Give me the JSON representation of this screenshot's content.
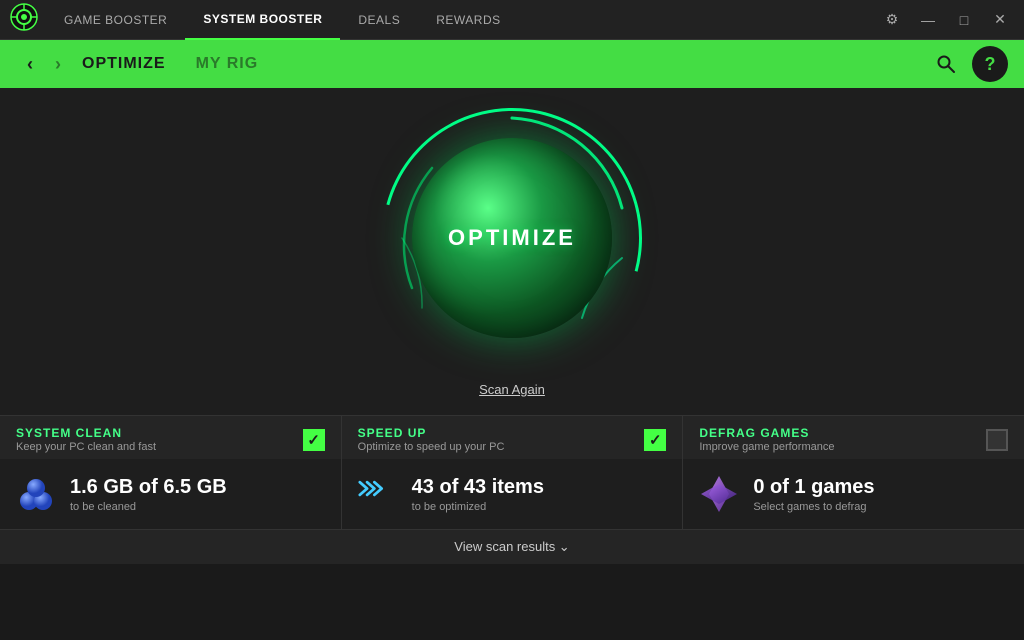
{
  "titlebar": {
    "logo_alt": "Razer Cortex Logo",
    "nav": [
      {
        "label": "GAME BOOSTER",
        "active": false
      },
      {
        "label": "SYSTEM BOOSTER",
        "active": true
      },
      {
        "label": "DEALS",
        "active": false
      },
      {
        "label": "REWARDS",
        "active": false
      }
    ],
    "controls": [
      "settings-icon",
      "minimize-icon",
      "maximize-icon",
      "close-icon"
    ]
  },
  "header": {
    "back_label": "‹",
    "forward_label": "›",
    "tabs": [
      {
        "label": "OPTIMIZE",
        "active": true
      },
      {
        "label": "MY RIG",
        "active": false
      }
    ],
    "search_label": "🔍",
    "help_label": "?"
  },
  "orb": {
    "label": "OPTIMIZE"
  },
  "scan_again": {
    "label": "Scan Again"
  },
  "cards": [
    {
      "id": "system-clean",
      "title": "SYSTEM CLEAN",
      "subtitle": "Keep your PC clean and fast",
      "checked": true,
      "icon": "bubbles-icon",
      "main_text": "1.6 GB of 6.5 GB",
      "detail": "to be cleaned"
    },
    {
      "id": "speed-up",
      "title": "SPEED UP",
      "subtitle": "Optimize to speed up your PC",
      "checked": true,
      "icon": "arrows-icon",
      "main_text": "43 of 43 items",
      "detail": "to be optimized"
    },
    {
      "id": "defrag-games",
      "title": "DEFRAG GAMES",
      "subtitle": "Improve game performance",
      "checked": false,
      "icon": "diamond-icon",
      "main_text": "0 of 1 games",
      "detail": "Select games to defrag"
    }
  ],
  "view_scan_results": {
    "label": "View scan results ⌄"
  }
}
